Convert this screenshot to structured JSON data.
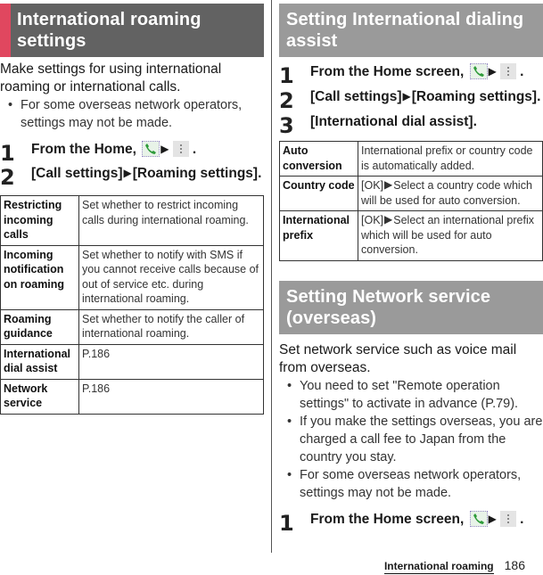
{
  "left": {
    "title": "International roaming settings",
    "intro": "Make settings for using international roaming or international calls.",
    "bullets": [
      "For some overseas network operators, settings may not be made."
    ],
    "steps": [
      {
        "num": "1",
        "text": "From the Home, ",
        "icons": [
          "phone-icon",
          "menu-icon"
        ],
        "suffix": " ."
      },
      {
        "num": "2",
        "text_a": "[Call settings]",
        "arrow": "▶",
        "text_b": "[Roaming settings]."
      }
    ],
    "table": [
      {
        "key": "Restricting incoming calls",
        "value": "Set whether to restrict incoming calls during international roaming."
      },
      {
        "key": "Incoming notification on roaming",
        "value": "Set whether to notify with SMS if you cannot receive calls because of out of service etc. during international roaming."
      },
      {
        "key": "Roaming guidance",
        "value": "Set whether to notify the caller of international roaming."
      },
      {
        "key": "International dial assist",
        "value": "P.186"
      },
      {
        "key": "Network service",
        "value": "P.186"
      }
    ]
  },
  "right": {
    "dial_assist": {
      "title": "Setting International dialing assist",
      "steps": [
        {
          "num": "1",
          "text": "From the Home screen, ",
          "suffix": " ."
        },
        {
          "num": "2",
          "text_a": "[Call settings]",
          "arrow": "▶",
          "text_b": "[Roaming settings]."
        },
        {
          "num": "3",
          "text": "[International dial assist]."
        }
      ],
      "table": [
        {
          "key": "Auto conversion",
          "value": "International prefix or country code is automatically added."
        },
        {
          "key": "Country code",
          "value_a": "[OK]",
          "arrow": "▶",
          "value_b": "Select a country code which will be used for auto conversion."
        },
        {
          "key": "International prefix",
          "value_a": "[OK]",
          "arrow": "▶",
          "value_b": "Select an international prefix which will be used for auto conversion."
        }
      ]
    },
    "network_service": {
      "title": "Setting Network service (overseas)",
      "intro": "Set network service such as voice mail from overseas.",
      "bullets": [
        "You need to set \"Remote operation settings\" to activate in advance (P.79).",
        "If you make the settings overseas, you are charged a call fee to Japan from the country you stay.",
        "For some overseas network operators, settings may not be made."
      ],
      "steps": [
        {
          "num": "1",
          "text": "From the Home screen, ",
          "suffix": " ."
        }
      ]
    }
  },
  "footer": {
    "section": "International roaming",
    "page": "186"
  },
  "bullet_glyph": "•",
  "colors": {
    "accent": "#e0475f",
    "header_dark": "#626262",
    "header_gray": "#9a9a9a"
  }
}
